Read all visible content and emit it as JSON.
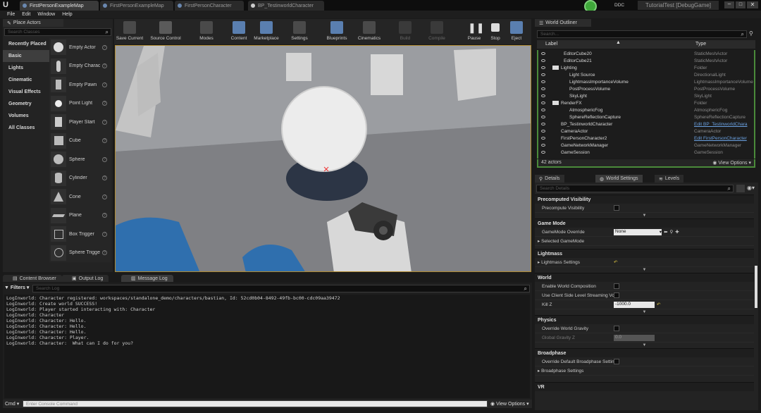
{
  "window": {
    "tabs": [
      {
        "label": "FirstPersonExampleMap"
      },
      {
        "label": "FirstPersonExampleMap"
      },
      {
        "label": "FirstPersonCharacter"
      },
      {
        "label": "BP_TestinworldCharacter"
      }
    ],
    "ddc_label": "DDC",
    "project_title": "TutorialTest [DebugGame]"
  },
  "menu": [
    "File",
    "Edit",
    "Window",
    "Help"
  ],
  "place_actors": {
    "title": "Place Actors",
    "search_placeholder": "Search Classes",
    "categories": [
      "Recently Placed",
      "Basic",
      "Lights",
      "Cinematic",
      "Visual Effects",
      "Geometry",
      "Volumes",
      "All Classes"
    ],
    "selected_category": "Basic",
    "actors": [
      "Empty Actor",
      "Empty Charac",
      "Empty Pawn",
      "Point Light",
      "Player Start",
      "Cube",
      "Sphere",
      "Cylinder",
      "Cone",
      "Plane",
      "Box Trigger",
      "Sphere Trigge"
    ]
  },
  "toolbar": [
    "Save Current",
    "Source Control",
    "Modes",
    "Content",
    "Marketplace",
    "Settings",
    "Blueprints",
    "Cinematics",
    "Build",
    "Compile",
    "Pause",
    "Stop",
    "Eject"
  ],
  "outliner": {
    "title": "World Outliner",
    "search_placeholder": "Search...",
    "col_label": "Label",
    "col_type": "Type",
    "rows": [
      {
        "label": "EditorCube20",
        "type": "StaticMeshActor"
      },
      {
        "label": "EditorCube21",
        "type": "StaticMeshActor"
      },
      {
        "label": "Lighting",
        "type": "Folder"
      },
      {
        "label": "Light Source",
        "type": "DirectionalLight"
      },
      {
        "label": "LightmassImportanceVolume",
        "type": "LightmassImportanceVolume"
      },
      {
        "label": "PostProcessVolume",
        "type": "PostProcessVolume"
      },
      {
        "label": "SkyLight",
        "type": "SkyLight"
      },
      {
        "label": "RenderFX",
        "type": "Folder"
      },
      {
        "label": "AtmosphericFog",
        "type": "AtmosphericFog"
      },
      {
        "label": "SphereReflectionCapture",
        "type": "SphereReflectionCapture"
      },
      {
        "label": "BP_TestinworldCharacter",
        "type": "Edit BP_TestinworldChara"
      },
      {
        "label": "CameraActor",
        "type": "CameraActor"
      },
      {
        "label": "FirstPersonCharacter2",
        "type": "Edit FirstPersonCharacter"
      },
      {
        "label": "GameNetworkManager",
        "type": "GameNetworkManager"
      },
      {
        "label": "GameSession",
        "type": "GameSession"
      }
    ],
    "actor_count": "42 actors",
    "view_options": "View Options"
  },
  "details": {
    "tabs": [
      "Details",
      "World Settings",
      "Levels"
    ],
    "search_placeholder": "Search Details",
    "precomputed_visibility": "Precomputed Visibility",
    "precompute_visibility": "Precompute Visibility",
    "game_mode": "Game Mode",
    "gamemode_override": "GameMode Override",
    "gamemode_value": "None",
    "selected_gamemode": "Selected GameMode",
    "lightmass": "Lightmass",
    "lightmass_settings": "Lightmass Settings",
    "world": "World",
    "enable_world_composition": "Enable World Composition",
    "use_client_side": "Use Client Side Level Streaming Vo",
    "kill_z": "Kill Z",
    "kill_z_value": "-1000.0",
    "physics": "Physics",
    "override_world_gravity": "Override World Gravity",
    "global_gravity_z": "Global Gravity Z",
    "global_gravity_value": "0.0",
    "broadphase": "Broadphase",
    "override_broadphase": "Override Default Broadphase Settin",
    "broadphase_settings": "Broadphase Settings",
    "vr": "VR"
  },
  "bottom": {
    "tabs": [
      "Content Browser",
      "Output Log",
      "Message Log"
    ],
    "filters": "Filters",
    "search_placeholder": "Search Log",
    "log_lines": [
      "LogInworld: Character registered: workspaces/standalone_demo/characters/bastian, Id: 52cd0b04-8492-49fb-bc00-cdc09aa39472",
      "LogInworld: Create world SUCCESS!",
      "LogInworld: Player started interacting with: Character",
      "LogInworld: Character",
      "LogInworld: Character: Hello.",
      "LogInworld: Character: Hello.",
      "LogInworld: Character: Hello.",
      "LogInworld: Character: Player.",
      "LogInworld: Character:  What can I do for you?"
    ],
    "cmd_label": "Cmd",
    "console_placeholder": "Enter Console Command",
    "view_options": "View Options"
  }
}
